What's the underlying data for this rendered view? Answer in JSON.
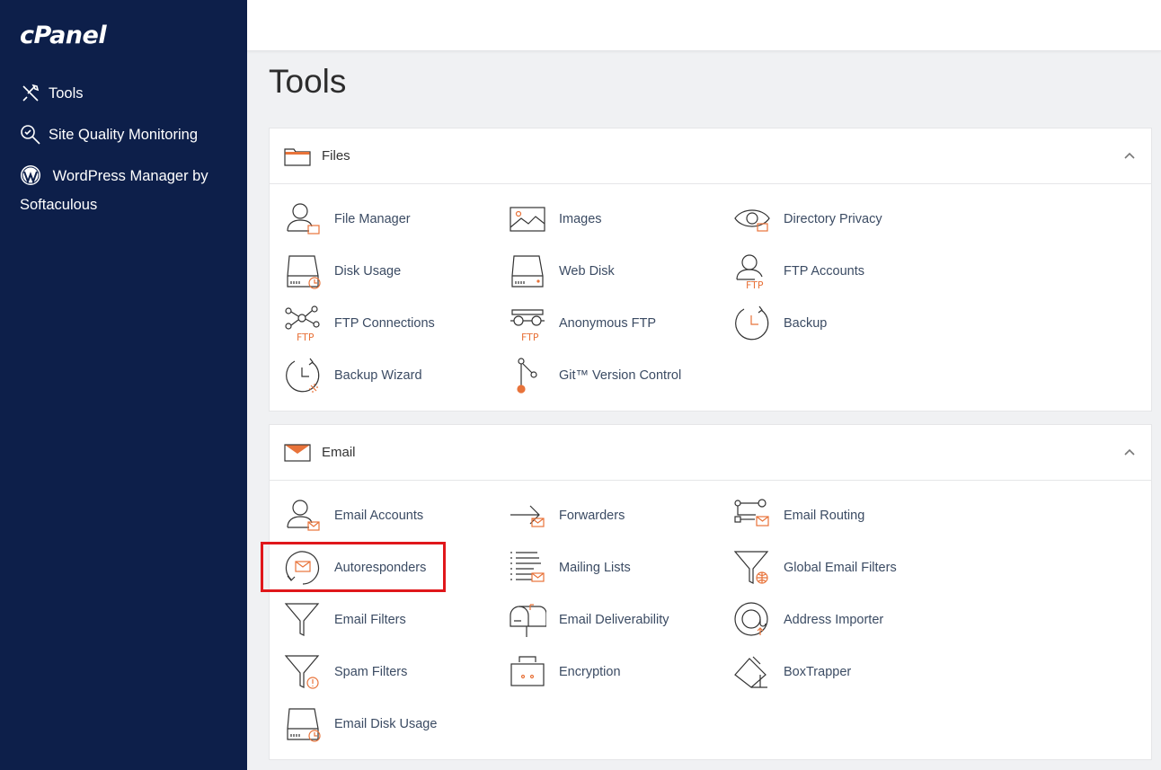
{
  "sidebar": {
    "logo": "cPanel",
    "items": [
      {
        "label": "Tools",
        "icon": "tools-icon"
      },
      {
        "label": "Site Quality Monitoring",
        "icon": "search-icon"
      },
      {
        "label": "WordPress Manager by Softaculous",
        "icon": "wordpress-icon"
      }
    ]
  },
  "page": {
    "title": "Tools"
  },
  "files": {
    "title": "Files",
    "tools": [
      {
        "label": "File Manager",
        "icon": "file-manager-icon"
      },
      {
        "label": "Images",
        "icon": "images-icon"
      },
      {
        "label": "Directory Privacy",
        "icon": "directory-privacy-icon"
      },
      {
        "label": "Disk Usage",
        "icon": "disk-usage-icon"
      },
      {
        "label": "Web Disk",
        "icon": "web-disk-icon"
      },
      {
        "label": "FTP Accounts",
        "icon": "ftp-accounts-icon"
      },
      {
        "label": "FTP Connections",
        "icon": "ftp-connections-icon"
      },
      {
        "label": "Anonymous FTP",
        "icon": "anonymous-ftp-icon"
      },
      {
        "label": "Backup",
        "icon": "backup-icon"
      },
      {
        "label": "Backup Wizard",
        "icon": "backup-wizard-icon"
      },
      {
        "label": "Git™ Version Control",
        "icon": "git-icon"
      }
    ]
  },
  "email": {
    "title": "Email",
    "tools": [
      {
        "label": "Email Accounts",
        "icon": "email-accounts-icon"
      },
      {
        "label": "Forwarders",
        "icon": "forwarders-icon"
      },
      {
        "label": "Email Routing",
        "icon": "email-routing-icon"
      },
      {
        "label": "Autoresponders",
        "icon": "autoresponders-icon"
      },
      {
        "label": "Mailing Lists",
        "icon": "mailing-lists-icon"
      },
      {
        "label": "Global Email Filters",
        "icon": "global-email-filters-icon"
      },
      {
        "label": "Email Filters",
        "icon": "email-filters-icon"
      },
      {
        "label": "Email Deliverability",
        "icon": "email-deliverability-icon"
      },
      {
        "label": "Address Importer",
        "icon": "address-importer-icon"
      },
      {
        "label": "Spam Filters",
        "icon": "spam-filters-icon"
      },
      {
        "label": "Encryption",
        "icon": "encryption-icon"
      },
      {
        "label": "BoxTrapper",
        "icon": "boxtrapper-icon"
      },
      {
        "label": "Email Disk Usage",
        "icon": "email-disk-usage-icon"
      }
    ]
  },
  "icon_text": {
    "ftp": "FTP"
  },
  "colors": {
    "sidebar_bg": "#0d1f4a",
    "accent": "#e8733a",
    "highlight": "#e0171b",
    "label": "#3b4b63"
  }
}
